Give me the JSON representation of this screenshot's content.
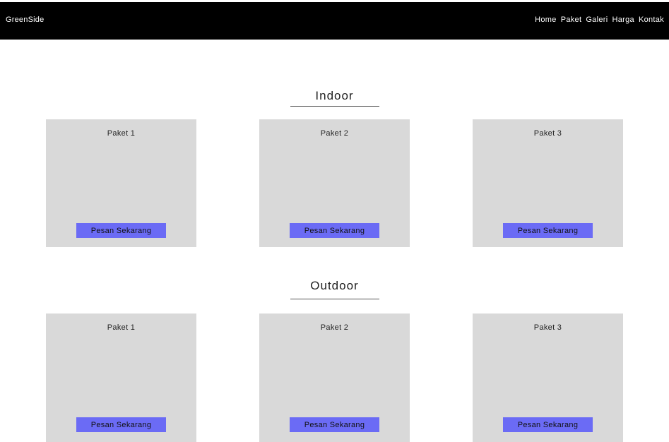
{
  "header": {
    "brand": "GreenSide",
    "nav": [
      "Home",
      "Paket",
      "Galeri",
      "Harga",
      "Kontak"
    ]
  },
  "sections": [
    {
      "title": "Indoor",
      "cards": [
        {
          "title": "Paket 1",
          "button": "Pesan Sekarang"
        },
        {
          "title": "Paket 2",
          "button": "Pesan Sekarang"
        },
        {
          "title": "Paket 3",
          "button": "Pesan Sekarang"
        }
      ]
    },
    {
      "title": "Outdoor",
      "cards": [
        {
          "title": "Paket 1",
          "button": "Pesan Sekarang"
        },
        {
          "title": "Paket 2",
          "button": "Pesan Sekarang"
        },
        {
          "title": "Paket 3",
          "button": "Pesan Sekarang"
        }
      ]
    }
  ],
  "colors": {
    "navbar": "#000000",
    "card": "#d9d9d9",
    "button": "#6b6bf5"
  }
}
